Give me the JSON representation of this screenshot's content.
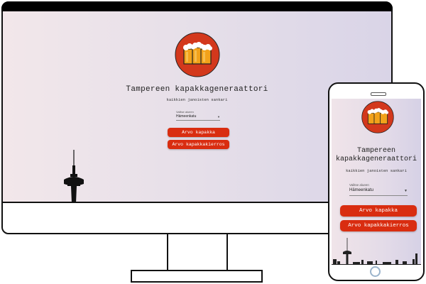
{
  "app": {
    "title": "Tampereen kapakkageneraattori",
    "subtitle": "kaikkien janoisten sankari",
    "select_label": "Valitse alueen",
    "select_value": "Hämeenkatu",
    "buttons": {
      "random_bar": "Arvo kapakka",
      "random_crawl": "Arvo kapakkakierros"
    },
    "icons": {
      "logo": "beer-mugs-icon",
      "select_arrow": "dropdown-arrow-icon"
    }
  },
  "colors": {
    "accent": "#d92d10",
    "logo_circle": "#d3381c",
    "beer": "#f2a21a",
    "gradient_start": "#f2e7ea",
    "gradient_end": "#d9d4e7"
  }
}
